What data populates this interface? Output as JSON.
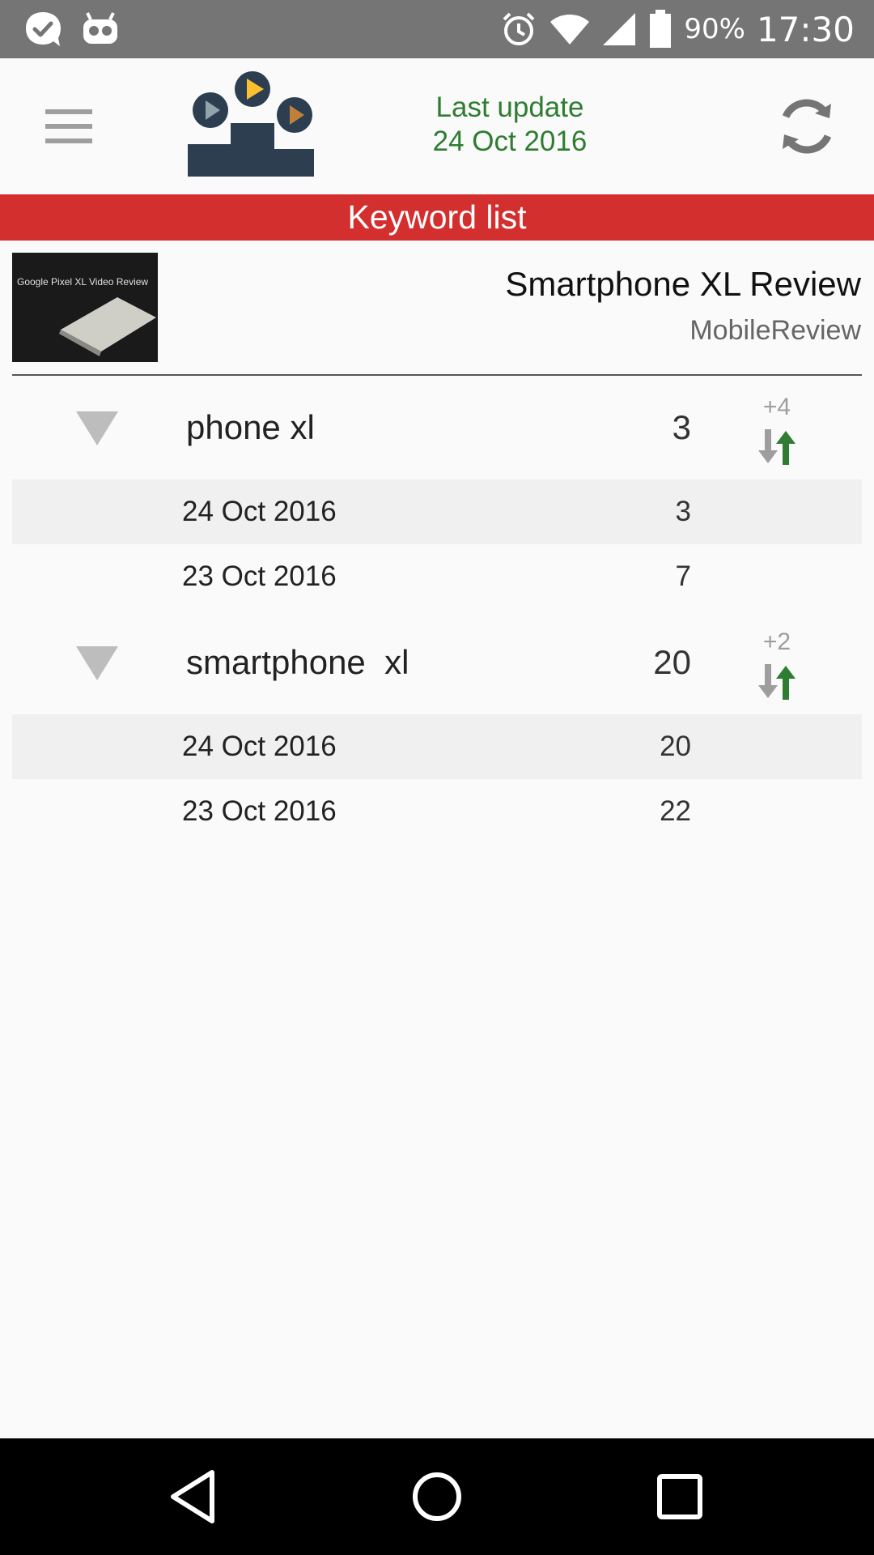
{
  "status_bar": {
    "battery_text": "90%",
    "time": "17:30",
    "icons": [
      "check-bubble-icon",
      "android-debug-icon",
      "alarm-icon",
      "wifi-icon",
      "signal-icon",
      "battery-icon"
    ]
  },
  "app_bar": {
    "last_update_label": "Last update",
    "last_update_date": "24 Oct 2016",
    "accent_color": "#2e7d32"
  },
  "section_header": {
    "title": "Keyword list",
    "color": "#d32f2f"
  },
  "video": {
    "thumbnail_text": "Google Pixel XL Video Review",
    "title": "Smartphone XL Review",
    "channel": "MobileReview"
  },
  "keywords": [
    {
      "name": "phone xl",
      "rank": "3",
      "change": "+4",
      "history": [
        {
          "date": "24 Oct 2016",
          "rank": "3"
        },
        {
          "date": "23 Oct 2016",
          "rank": "7"
        }
      ]
    },
    {
      "name": "smartphone  xl",
      "rank": "20",
      "change": "+2",
      "history": [
        {
          "date": "24 Oct 2016",
          "rank": "20"
        },
        {
          "date": "23 Oct 2016",
          "rank": "22"
        }
      ]
    }
  ]
}
